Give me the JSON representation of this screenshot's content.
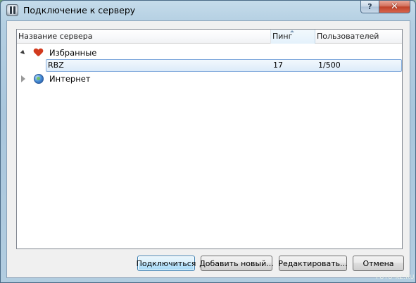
{
  "window": {
    "title": "Подключение к серверу",
    "help_label": "?",
    "close_label": "✕"
  },
  "table": {
    "columns": [
      "Название сервера",
      "Пинг",
      "Пользователей"
    ],
    "sorted_column": "Пинг",
    "groups": [
      {
        "label": "Избранные",
        "icon": "heart-icon",
        "expanded": true,
        "servers": [
          {
            "name": "RBZ",
            "ping": "17",
            "users": "1/500",
            "selected": true
          }
        ]
      },
      {
        "label": "Интернет",
        "icon": "globe-icon",
        "expanded": false,
        "servers": []
      }
    ]
  },
  "buttons": {
    "connect": "Подключиться",
    "add": "Добавить новый...",
    "edit": "Редактировать...",
    "cancel": "Отмена"
  },
  "watermark": "FOTO-KZ.RU",
  "colors": {
    "selection_border": "#84acdd",
    "selection_fill": "#dcebf9",
    "heart": "#d23a1e",
    "close_button": "#c0422a"
  }
}
